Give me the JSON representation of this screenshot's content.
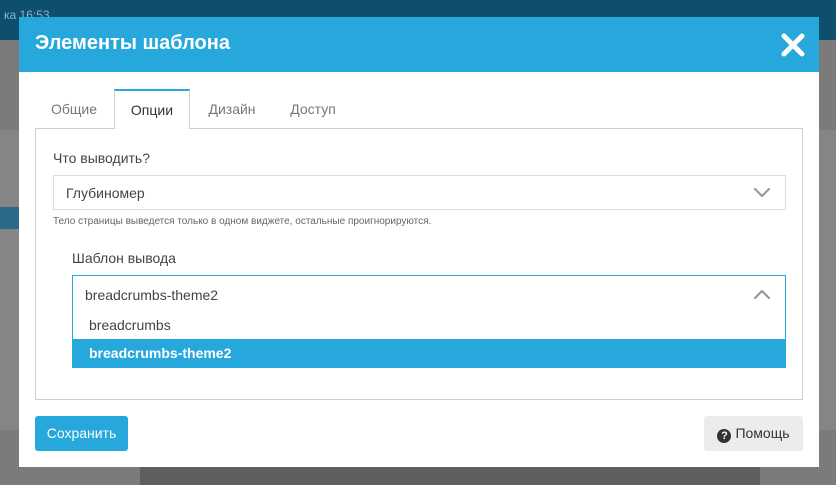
{
  "background": {
    "topbar_text": "ка 16:53"
  },
  "modal": {
    "title": "Элементы шаблона",
    "close_icon": "close-icon"
  },
  "tabs": [
    {
      "label": "Общие",
      "active": false
    },
    {
      "label": "Опции",
      "active": true
    },
    {
      "label": "Дизайн",
      "active": false
    },
    {
      "label": "Доступ",
      "active": false
    }
  ],
  "form": {
    "output_label": "Что выводить?",
    "output_value": "Глубиномер",
    "output_hint": "Тело страницы выведется только в одном виджете, остальные проигнорируются.",
    "template_label": "Шаблон вывода",
    "template_value": "breadcrumbs-theme2",
    "template_options": [
      {
        "label": "breadcrumbs",
        "selected": false
      },
      {
        "label": "breadcrumbs-theme2",
        "selected": true
      }
    ]
  },
  "buttons": {
    "save": "Сохранить",
    "help": "Помощь",
    "help_icon": "question-circle-icon"
  },
  "colors": {
    "accent": "#27a8dc",
    "header_text": "#ffffff"
  }
}
